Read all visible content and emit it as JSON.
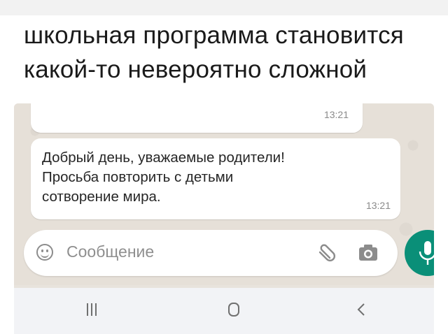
{
  "caption": {
    "line1": "школьная программа становится",
    "line2": "какой-то невероятно сложной"
  },
  "chat": {
    "previous_message": {
      "time": "13:21"
    },
    "message": {
      "lines": [
        "Добрый день, уважаемые родители!",
        "Просьба повторить с детьми",
        "сотворение мира."
      ],
      "time": "13:21"
    }
  },
  "composer": {
    "placeholder": "Сообщение",
    "icons": [
      "emoji-icon",
      "attach-icon",
      "camera-icon",
      "mic-icon"
    ]
  },
  "navbar": {
    "icons": [
      "recent-apps-icon",
      "home-icon",
      "back-icon"
    ]
  },
  "colors": {
    "accent": "#0a8f78",
    "bubble": "#ffffff",
    "wallpaper": "#e6e0d8"
  }
}
